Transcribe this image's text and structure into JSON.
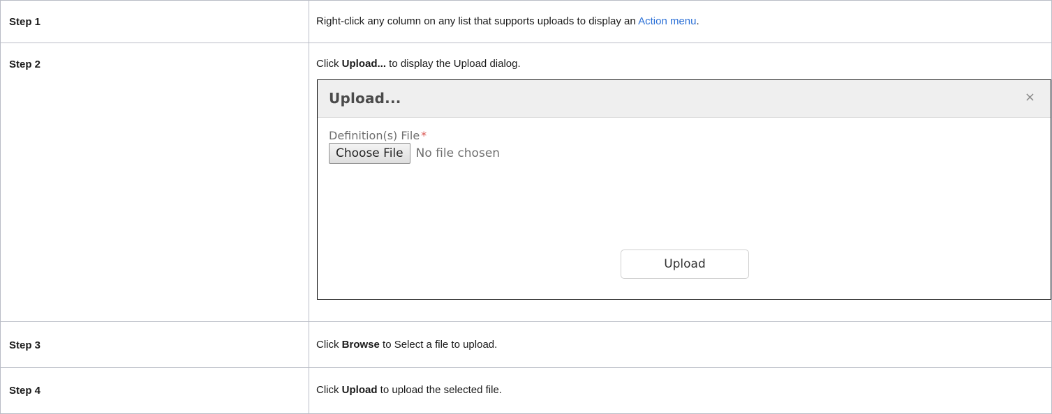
{
  "steps": [
    {
      "label": "Step 1",
      "text_before": "Right-click any column on any list that supports uploads to display an ",
      "link": "Action menu",
      "text_after": "."
    },
    {
      "label": "Step 2",
      "text_before": "Click ",
      "bold": "Upload...",
      "text_after": " to display the Upload dialog."
    },
    {
      "label": "Step 3",
      "text_before": "Click ",
      "bold": "Browse",
      "text_after": " to Select a file to upload."
    },
    {
      "label": "Step 4",
      "text_before": "Click ",
      "bold": "Upload",
      "text_after": " to upload the selected file."
    }
  ],
  "dialog": {
    "title": "Upload...",
    "close": "×",
    "field_label": "Definition(s) File",
    "required_mark": "*",
    "choose_file": "Choose File",
    "no_file": "No file chosen",
    "upload_button": "Upload"
  },
  "colors": {
    "link": "#2a6fd6",
    "border": "#b9bcc6",
    "required": "#d9534f"
  }
}
